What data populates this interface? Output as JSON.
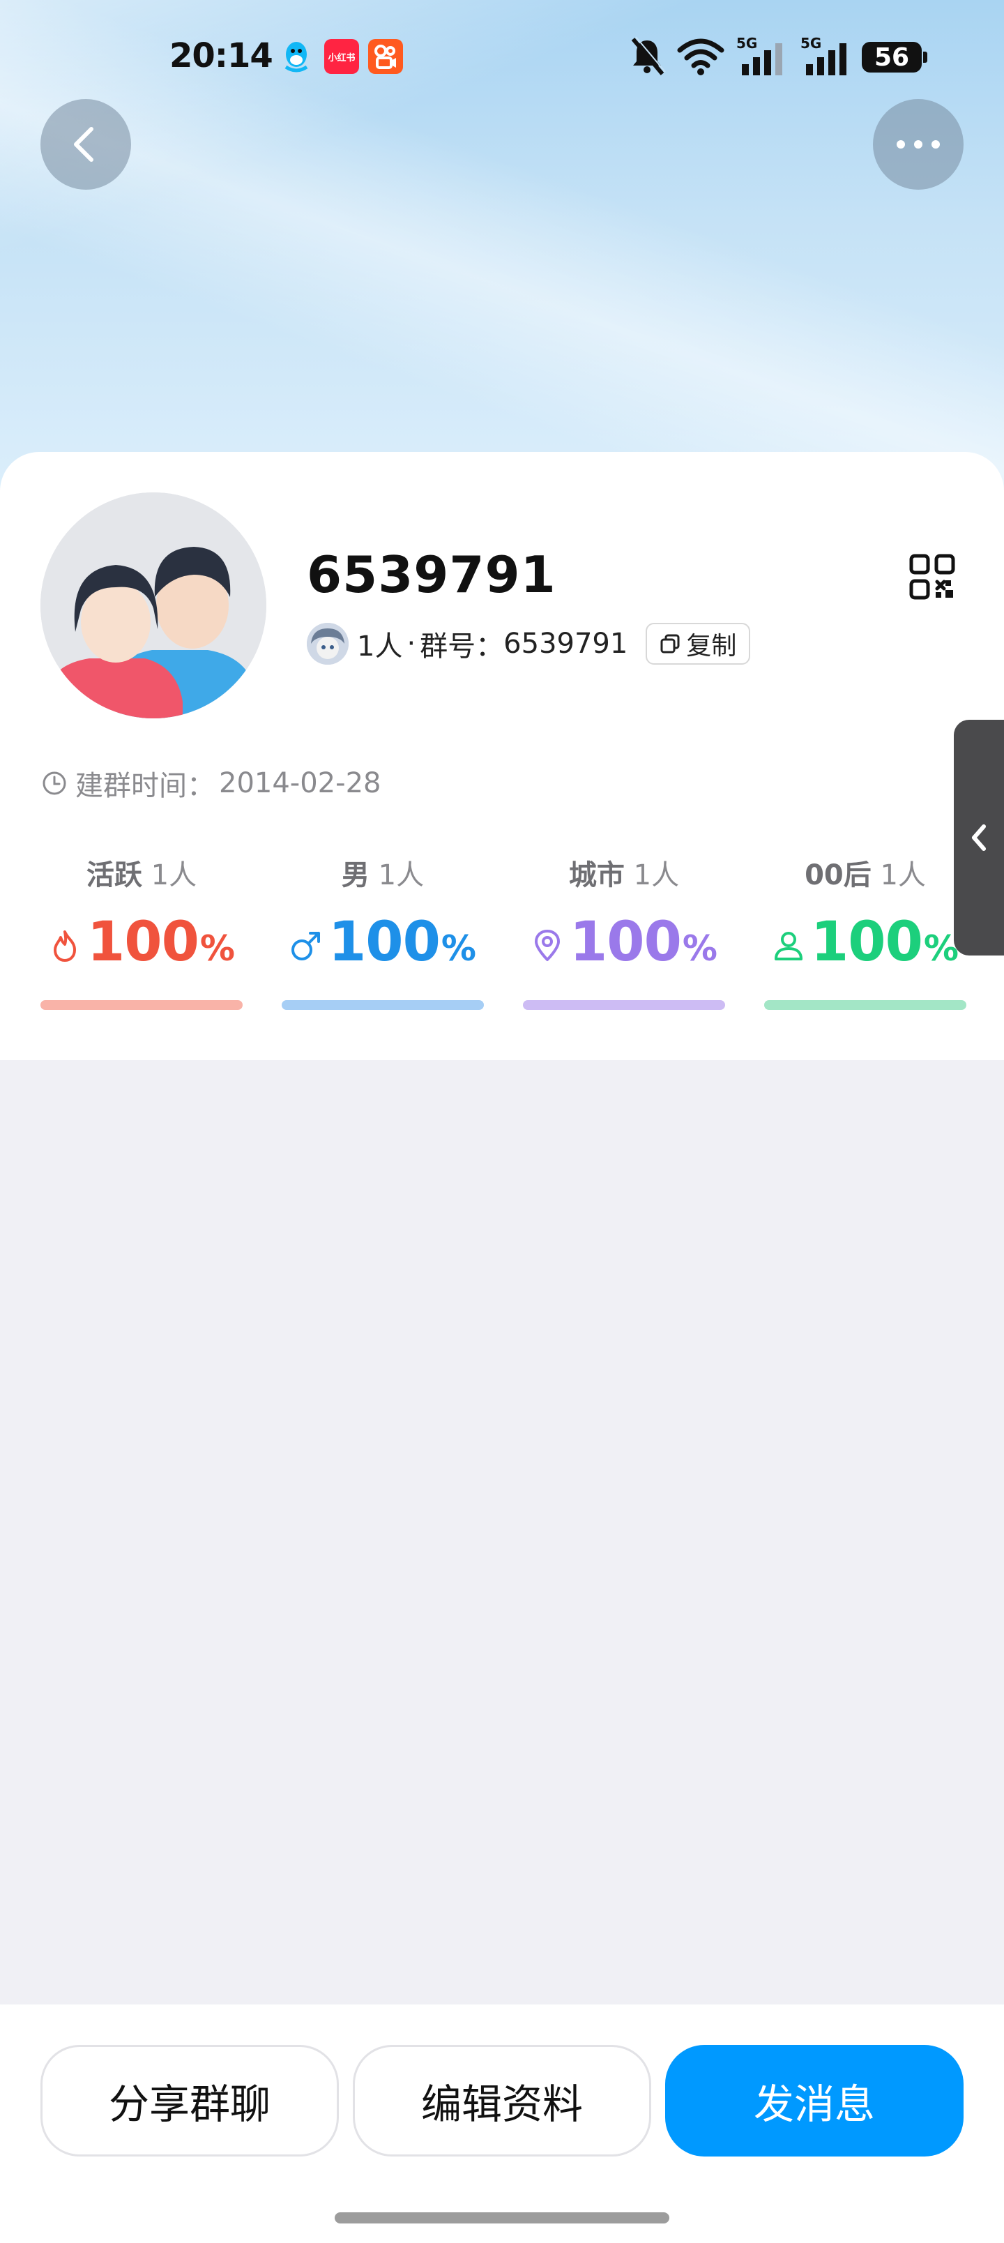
{
  "status_bar": {
    "time": "20:14",
    "xhs_label": "小红书",
    "signal_1": "5G",
    "signal_2": "5G",
    "battery": "56"
  },
  "header": {
    "back_icon": "chevron-left-icon",
    "more_icon": "more-horizontal-icon"
  },
  "group": {
    "name": "6539791",
    "member_count": "1人",
    "separator": "·",
    "id_label": "群号：",
    "id_value": "6539791",
    "copy_label": "复制",
    "created_label": "建群时间：",
    "created_value": "2014-02-28"
  },
  "stats": [
    {
      "title": "活跃",
      "count": "1人",
      "value": "100",
      "unit": "%",
      "icon": "flame-icon",
      "color": "#f0533d",
      "bar_color": "#f9b3a8"
    },
    {
      "title": "男",
      "count": "1人",
      "value": "100",
      "unit": "%",
      "icon": "male-icon",
      "color": "#1e90e8",
      "bar_color": "#a6cef5"
    },
    {
      "title": "城市",
      "count": "1人",
      "value": "100",
      "unit": "%",
      "icon": "location-pin-icon",
      "color": "#9a79ea",
      "bar_color": "#cdbcf4"
    },
    {
      "title": "00后",
      "count": "1人",
      "value": "100",
      "unit": "%",
      "icon": "person-icon",
      "color": "#1ccf7c",
      "bar_color": "#a3e6c6"
    }
  ],
  "actions": {
    "share": "分享群聊",
    "edit": "编辑资料",
    "send": "发消息"
  },
  "colors": {
    "primary": "#0099ff",
    "card": "#ffffff",
    "page_bg": "#f0f0f5"
  }
}
